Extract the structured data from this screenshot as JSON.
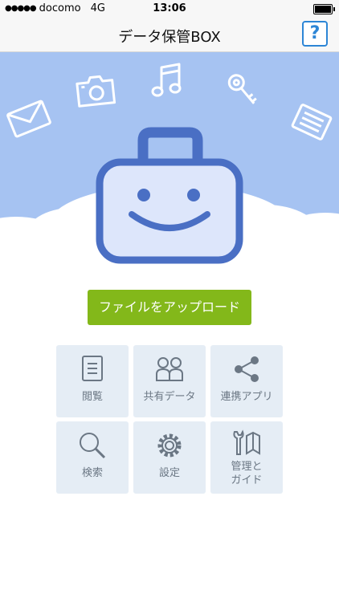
{
  "status_bar": {
    "signal": "●●●●●",
    "carrier": "docomo",
    "network": "4G",
    "time": "13:06"
  },
  "nav": {
    "title": "データ保管BOX",
    "help_label": "?"
  },
  "upload_button": "ファイルをアップロード",
  "menu": {
    "view": "閲覧",
    "shared": "共有データ",
    "apps": "連携アプリ",
    "search": "検索",
    "settings": "設定",
    "manage_line1": "管理と",
    "manage_line2": "ガイド"
  },
  "colors": {
    "sky": "#a6c3f2",
    "cloud": "#ffffff",
    "bag_stroke": "#4a6fc4",
    "bag_fill": "#dde6fb",
    "upload": "#83b81a",
    "tile": "#e5edf5",
    "tile_text": "#6b7784",
    "help": "#2d86d6"
  },
  "icons": [
    "envelope-icon",
    "camera-icon",
    "music-note-icon",
    "key-icon",
    "document-icon",
    "briefcase-icon",
    "help-icon",
    "document-list-icon",
    "people-icon",
    "share-icon",
    "search-icon",
    "gear-icon",
    "tools-guide-icon"
  ]
}
